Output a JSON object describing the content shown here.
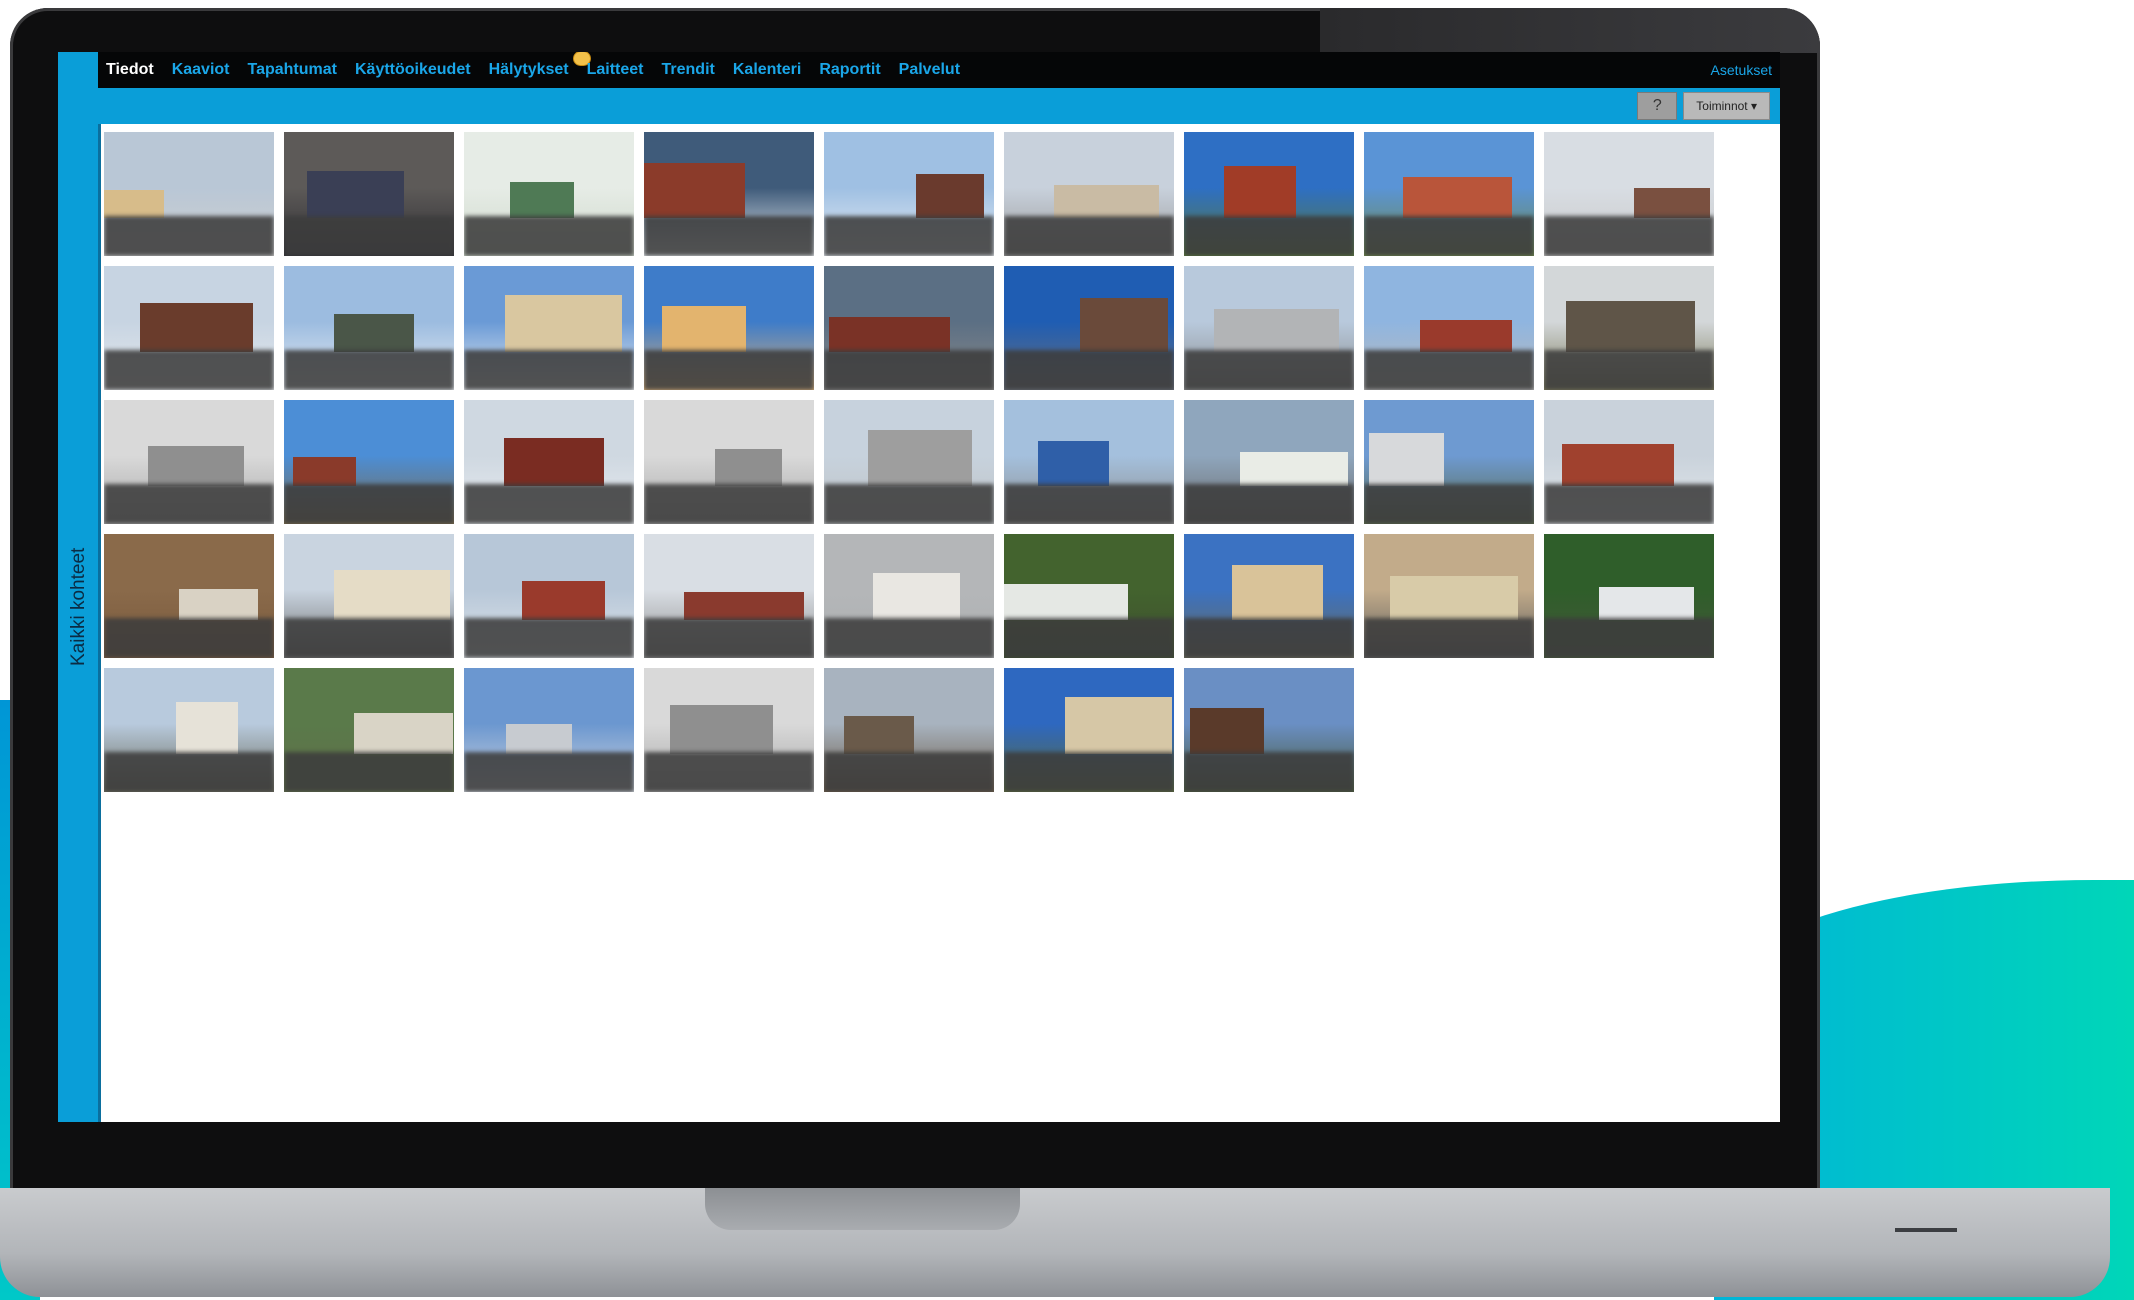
{
  "nav": {
    "items": [
      {
        "label": "Tiedot",
        "active": true
      },
      {
        "label": "Kaaviot"
      },
      {
        "label": "Tapahtumat"
      },
      {
        "label": "Käyttöoikeudet"
      },
      {
        "label": "Hälytykset",
        "badge": true
      },
      {
        "label": "Laitteet"
      },
      {
        "label": "Trendit"
      },
      {
        "label": "Kalenteri"
      },
      {
        "label": "Raportit"
      },
      {
        "label": "Palvelut"
      }
    ],
    "settings_label": "Asetukset"
  },
  "toolbar": {
    "help_label": "?",
    "actions_label": "Toiminnot ▾"
  },
  "sidebar": {
    "label": "Kaikki kohteet"
  },
  "colors": {
    "accent": "#0a9ed8",
    "nav_bg": "#050607",
    "nav_link": "#1aa6e8"
  },
  "tiles": [
    {
      "sky": "#b9c7d6",
      "ground": "#cfcfcf",
      "bld": "#d7bc8a"
    },
    {
      "sky": "#5d5a58",
      "ground": "#2f2f34",
      "bld": "#3a3f55"
    },
    {
      "sky": "#e6ece6",
      "ground": "#cfd9cb",
      "bld": "#4f7a55"
    },
    {
      "sky": "#3f5b7a",
      "ground": "#e9eef2",
      "bld": "#8b3b2a"
    },
    {
      "sky": "#9fc0e3",
      "ground": "#e7ecf2",
      "bld": "#6a3a2d"
    },
    {
      "sky": "#c8d1dc",
      "ground": "#9b9b9b",
      "bld": "#c9bba4"
    },
    {
      "sky": "#2e6fc4",
      "ground": "#5a7a3a",
      "bld": "#a13c27"
    },
    {
      "sky": "#5a94d6",
      "ground": "#6f8a4a",
      "bld": "#b9553a"
    },
    {
      "sky": "#d8dde3",
      "ground": "#c9c9c9",
      "bld": "#7a5040"
    },
    {
      "sky": "#c7d4e2",
      "ground": "#e6eaee",
      "bld": "#6a3c2c"
    },
    {
      "sky": "#9cbce0",
      "ground": "#e8edf2",
      "bld": "#4a5648"
    },
    {
      "sky": "#6a9ad6",
      "ground": "#e9edf1",
      "bld": "#d9c7a0"
    },
    {
      "sky": "#3e7cc9",
      "ground": "#d9b07a",
      "bld": "#e3b46e"
    },
    {
      "sky": "#5b6f84",
      "ground": "#8a8a8a",
      "bld": "#7a3226"
    },
    {
      "sky": "#1f5db3",
      "ground": "#6a6f7a",
      "bld": "#6a4a3a"
    },
    {
      "sky": "#b8c9dc",
      "ground": "#8b8d8f",
      "bld": "#b2b4b6"
    },
    {
      "sky": "#8fb5e0",
      "ground": "#bbbbbb",
      "bld": "#9a3a2c"
    },
    {
      "sky": "#d3d7d9",
      "ground": "#7b7a5a",
      "bld": "#5f5548"
    },
    {
      "sky": "#d9d9d9",
      "ground": "#a9a9a9",
      "bld": "#8f8f8f"
    },
    {
      "sky": "#4c8ed6",
      "ground": "#7a6a4a",
      "bld": "#8a3a2a"
    },
    {
      "sky": "#cfd8e1",
      "ground": "#e8ecf0",
      "bld": "#7a2c22"
    },
    {
      "sky": "#d9d9d9",
      "ground": "#a9a9a9",
      "bld": "#8f8f8f"
    },
    {
      "sky": "#c7d2dd",
      "ground": "#bfc3c6",
      "bld": "#9e9e9e"
    },
    {
      "sky": "#a4c0dd",
      "ground": "#8e8e8e",
      "bld": "#2f5fa8"
    },
    {
      "sky": "#8fa6bd",
      "ground": "#6b6b6b",
      "bld": "#e9ece6"
    },
    {
      "sky": "#6e9ad1",
      "ground": "#5a6a4a",
      "bld": "#d7d9db"
    },
    {
      "sky": "#c9d2db",
      "ground": "#e4e8ec",
      "bld": "#a0412e"
    },
    {
      "sky": "#8a6a4a",
      "ground": "#7a5a3e",
      "bld": "#d9d2c4"
    },
    {
      "sky": "#c9d4e0",
      "ground": "#6f6f6f",
      "bld": "#e5dcc6"
    },
    {
      "sky": "#b7c7d8",
      "ground": "#e0e5ea",
      "bld": "#9a3a2c"
    },
    {
      "sky": "#d9dee4",
      "ground": "#8f8f8f",
      "bld": "#8a3a2e"
    },
    {
      "sky": "#b4b6b8",
      "ground": "#aeb1b3",
      "bld": "#e9e7e2"
    },
    {
      "sky": "#43632e",
      "ground": "#3e4e30",
      "bld": "#e5e8e4"
    },
    {
      "sky": "#3b72c2",
      "ground": "#6a6a5a",
      "bld": "#d9c399"
    },
    {
      "sky": "#c2ab8a",
      "ground": "#5e5e5e",
      "bld": "#d8cba8"
    },
    {
      "sky": "#2f5e2a",
      "ground": "#43563a",
      "bld": "#e4e7e9"
    },
    {
      "sky": "#b8cadd",
      "ground": "#6a6a5a",
      "bld": "#e6e2d8"
    },
    {
      "sky": "#5a7a4a",
      "ground": "#5f6f4a",
      "bld": "#d9d4c6"
    },
    {
      "sky": "#6b97d0",
      "ground": "#ced4dc",
      "bld": "#c7cbd0"
    },
    {
      "sky": "#d9d9d9",
      "ground": "#a9a9a9",
      "bld": "#8f8f8f"
    },
    {
      "sky": "#a8b3bf",
      "ground": "#6b5b48",
      "bld": "#6a5a4a"
    },
    {
      "sky": "#2e68c0",
      "ground": "#5a6a3a",
      "bld": "#d6c7a6"
    },
    {
      "sky": "#6a8fc4",
      "ground": "#4a5a3a",
      "bld": "#5a3a2a"
    }
  ]
}
